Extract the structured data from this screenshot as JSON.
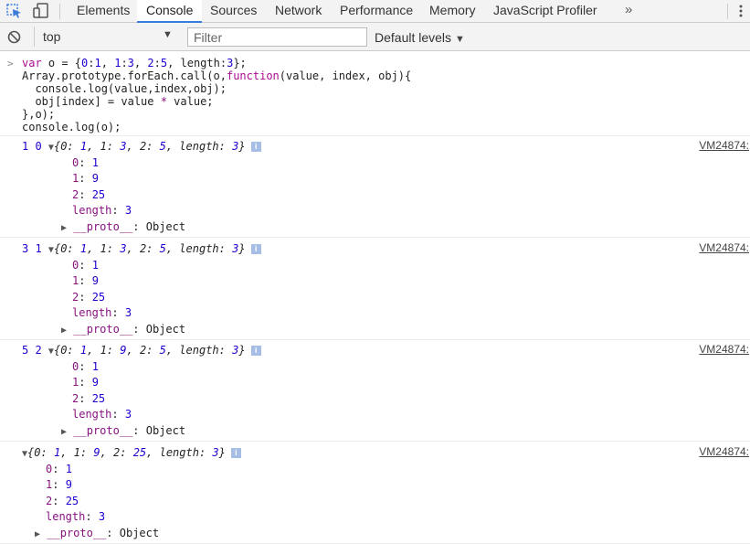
{
  "tabs": {
    "elements": "Elements",
    "console": "Console",
    "sources": "Sources",
    "network": "Network",
    "performance": "Performance",
    "memory": "Memory",
    "profiler": "JavaScript Profiler",
    "overflow": "»"
  },
  "toolbar": {
    "context": "top",
    "filter_placeholder": "Filter",
    "levels": "Default levels"
  },
  "code": {
    "l1": [
      "var",
      " o = {",
      "0",
      ":",
      "1",
      ", ",
      "1",
      ":",
      "3",
      ", ",
      "2",
      ":",
      "5",
      ", length:",
      "3",
      "};"
    ],
    "l2": [
      "Array.prototype.forEach.call(o,",
      "function",
      "(value, index, obj){"
    ],
    "l3": "  console.log(value,index,obj);",
    "l4a": "  obj[index] = value ",
    "l4op": "*",
    "l4b": " value;",
    "l5": "},o);",
    "l6": "console.log(o);"
  },
  "logs": [
    {
      "nums": "1 0",
      "summary": [
        "{",
        "0",
        ": ",
        "1",
        ", ",
        "1",
        ": ",
        "3",
        ", ",
        "2",
        ": ",
        "5",
        ", length: ",
        "3",
        "}"
      ],
      "props": [
        [
          "0",
          "1"
        ],
        [
          "1",
          "9"
        ],
        [
          "2",
          "25"
        ],
        [
          "length",
          "3"
        ]
      ],
      "proto": "__proto__",
      "proto_val": "Object",
      "source": "VM24874:"
    },
    {
      "nums": "3 1",
      "summary": [
        "{",
        "0",
        ": ",
        "1",
        ", ",
        "1",
        ": ",
        "3",
        ", ",
        "2",
        ": ",
        "5",
        ", length: ",
        "3",
        "}"
      ],
      "props": [
        [
          "0",
          "1"
        ],
        [
          "1",
          "9"
        ],
        [
          "2",
          "25"
        ],
        [
          "length",
          "3"
        ]
      ],
      "proto": "__proto__",
      "proto_val": "Object",
      "source": "VM24874:"
    },
    {
      "nums": "5 2",
      "summary": [
        "{",
        "0",
        ": ",
        "1",
        ", ",
        "1",
        ": ",
        "9",
        ", ",
        "2",
        ": ",
        "5",
        ", length: ",
        "3",
        "}"
      ],
      "props": [
        [
          "0",
          "1"
        ],
        [
          "1",
          "9"
        ],
        [
          "2",
          "25"
        ],
        [
          "length",
          "3"
        ]
      ],
      "proto": "__proto__",
      "proto_val": "Object",
      "source": "VM24874:"
    },
    {
      "nums": "",
      "summary": [
        "{",
        "0",
        ": ",
        "1",
        ", ",
        "1",
        ": ",
        "9",
        ", ",
        "2",
        ": ",
        "25",
        ", length: ",
        "3",
        "}"
      ],
      "props": [
        [
          "0",
          "1"
        ],
        [
          "1",
          "9"
        ],
        [
          "2",
          "25"
        ],
        [
          "length",
          "3"
        ]
      ],
      "proto": "__proto__",
      "proto_val": "Object",
      "source": "VM24874:"
    }
  ],
  "info_badge": "i",
  "colors": {
    "accent": "#3b7ddd",
    "number": "#1c00cf",
    "keyword": "#aa0d91",
    "property": "#881280"
  }
}
